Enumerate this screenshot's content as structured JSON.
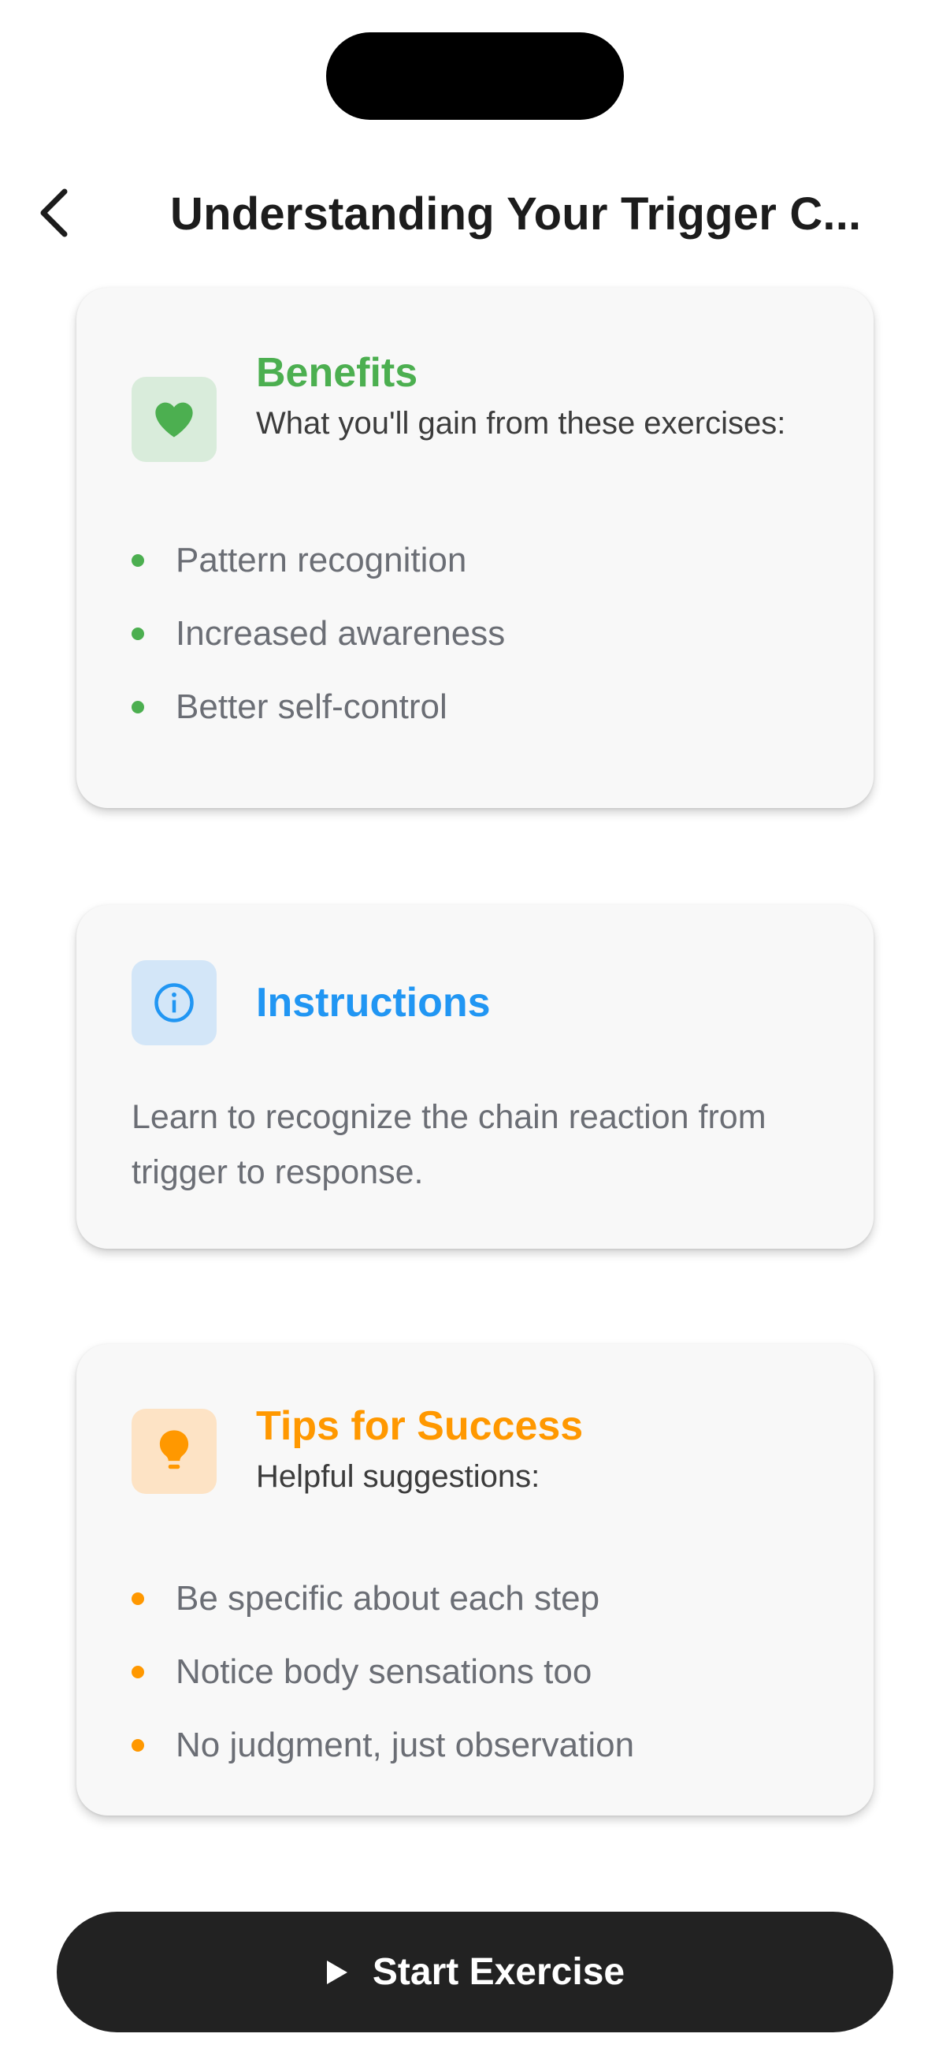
{
  "header": {
    "title": "Understanding Your Trigger C...",
    "back_icon": "chevron-left-icon"
  },
  "benefits": {
    "title": "Benefits",
    "subtitle": "What you'll gain from these exercises:",
    "icon": "heart-icon",
    "accent_color": "#4caf50",
    "icon_bg": "#d9ecdb",
    "items": [
      "Pattern recognition",
      "Increased awareness",
      "Better self-control"
    ]
  },
  "instructions": {
    "title": "Instructions",
    "icon": "info-icon",
    "accent_color": "#2196f3",
    "icon_bg": "#d3e6f8",
    "text": "Learn to recognize the chain reaction from trigger to response."
  },
  "tips": {
    "title": "Tips for Success",
    "subtitle": "Helpful suggestions:",
    "icon": "lightbulb-icon",
    "accent_color": "#ff9800",
    "icon_bg": "#fde3c5",
    "items": [
      "Be specific about each step",
      "Notice body sensations too",
      "No judgment, just observation"
    ]
  },
  "footer": {
    "start_label": "Start Exercise",
    "start_icon": "play-icon"
  }
}
